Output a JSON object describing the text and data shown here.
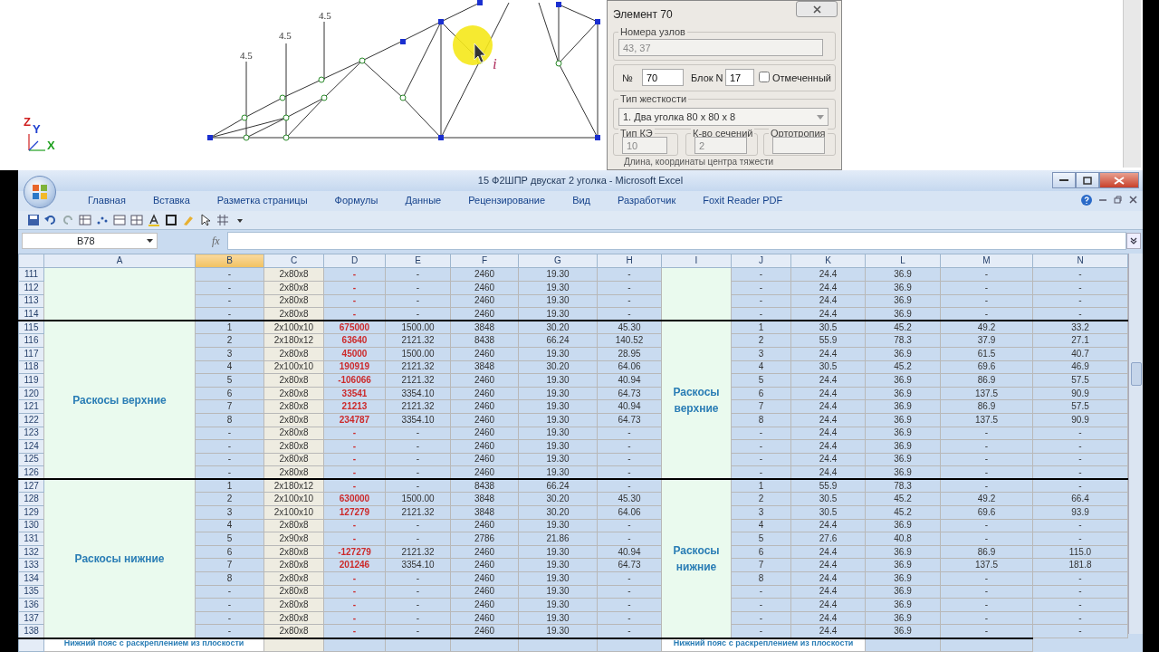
{
  "cad": {
    "load_labels": [
      "4.5",
      "4.5",
      "4.5"
    ],
    "cursor_label": "i",
    "axes": [
      "Z",
      "Y",
      "X"
    ]
  },
  "dialog": {
    "title": "Элемент 70",
    "nodes_group": "Номера узлов",
    "nodes_value": "43, 37",
    "number_label": "№",
    "number_value": "70",
    "block_label": "Блок N",
    "block_value": "17",
    "marked": {
      "label": "Отмеченный",
      "checked": false
    },
    "stiffness_group": "Тип жесткости",
    "stiffness_value": "1. Два уголка 80 x 80 x 8",
    "fields": [
      {
        "label": "Тип КЭ",
        "value": "10"
      },
      {
        "label": "К-во сечений",
        "value": "2"
      },
      {
        "label": "Ортотропия"
      }
    ],
    "cut_text": "Длина, координаты центра тяжести"
  },
  "excel": {
    "title": "15 Ф2ШПР двускат 2 уголка - Microsoft Excel",
    "ribbon_tabs": [
      "Главная",
      "Вставка",
      "Разметка страницы",
      "Формулы",
      "Данные",
      "Рецензирование",
      "Вид",
      "Разработчик",
      "Foxit Reader PDF"
    ],
    "name_box": "B78",
    "function_label": "fx",
    "columns": [
      {
        "label": "A",
        "selected": false
      },
      {
        "label": "B",
        "selected": true
      },
      {
        "label": "C",
        "selected": false
      },
      {
        "label": "D",
        "selected": false
      },
      {
        "label": "E",
        "selected": false
      },
      {
        "label": "F",
        "selected": false
      },
      {
        "label": "G",
        "selected": false
      },
      {
        "label": "H",
        "selected": false
      },
      {
        "label": "I",
        "selected": false
      },
      {
        "label": "J",
        "selected": false
      },
      {
        "label": "K",
        "selected": false
      },
      {
        "label": "L",
        "selected": false
      },
      {
        "label": "M",
        "selected": false
      },
      {
        "label": "N",
        "selected": false
      }
    ],
    "groups": [
      {
        "rows": [
          {
            "number": "111",
            "cells": [
              "-",
              "2x80x8",
              "-",
              "-",
              "2460",
              "19.30",
              "-",
              "-",
              "24.4",
              "36.9",
              "-",
              "-"
            ]
          },
          {
            "number": "112",
            "cells": [
              "-",
              "2x80x8",
              "-",
              "-",
              "2460",
              "19.30",
              "-",
              "-",
              "24.4",
              "36.9",
              "-",
              "-"
            ]
          },
          {
            "number": "113",
            "cells": [
              "-",
              "2x80x8",
              "-",
              "-",
              "2460",
              "19.30",
              "-",
              "-",
              "24.4",
              "36.9",
              "-",
              "-"
            ]
          },
          {
            "number": "114",
            "cells": [
              "-",
              "2x80x8",
              "-",
              "-",
              "2460",
              "19.30",
              "-",
              "-",
              "24.4",
              "36.9",
              "-",
              "-"
            ]
          }
        ]
      },
      {
        "label_left": "Раскосы верхние",
        "label_right": "Раскосы верхние",
        "rows": [
          {
            "number": "115",
            "cells": [
              "1",
              "2x100x10",
              "675000",
              "1500.00",
              "3848",
              "30.20",
              "45.30",
              "1",
              "30.5",
              "45.2",
              "49.2",
              "33.2"
            ]
          },
          {
            "number": "116",
            "cells": [
              "2",
              "2x180x12",
              "63640",
              "2121.32",
              "8438",
              "66.24",
              "140.52",
              "2",
              "55.9",
              "78.3",
              "37.9",
              "27.1"
            ]
          },
          {
            "number": "117",
            "cells": [
              "3",
              "2x80x8",
              "45000",
              "1500.00",
              "2460",
              "19.30",
              "28.95",
              "3",
              "24.4",
              "36.9",
              "61.5",
              "40.7"
            ]
          },
          {
            "number": "118",
            "cells": [
              "4",
              "2x100x10",
              "190919",
              "2121.32",
              "3848",
              "30.20",
              "64.06",
              "4",
              "30.5",
              "45.2",
              "69.6",
              "46.9"
            ]
          },
          {
            "number": "119",
            "cells": [
              "5",
              "2x80x8",
              "-106066",
              "2121.32",
              "2460",
              "19.30",
              "40.94",
              "5",
              "24.4",
              "36.9",
              "86.9",
              "57.5"
            ]
          },
          {
            "number": "120",
            "cells": [
              "6",
              "2x80x8",
              "33541",
              "3354.10",
              "2460",
              "19.30",
              "64.73",
              "6",
              "24.4",
              "36.9",
              "137.5",
              "90.9"
            ]
          },
          {
            "number": "121",
            "cells": [
              "7",
              "2x80x8",
              "21213",
              "2121.32",
              "2460",
              "19.30",
              "40.94",
              "7",
              "24.4",
              "36.9",
              "86.9",
              "57.5"
            ]
          },
          {
            "number": "122",
            "cells": [
              "8",
              "2x80x8",
              "234787",
              "3354.10",
              "2460",
              "19.30",
              "64.73",
              "8",
              "24.4",
              "36.9",
              "137.5",
              "90.9"
            ]
          },
          {
            "number": "123",
            "cells": [
              "-",
              "2x80x8",
              "-",
              "-",
              "2460",
              "19.30",
              "-",
              "-",
              "24.4",
              "36.9",
              "-",
              "-"
            ]
          },
          {
            "number": "124",
            "cells": [
              "-",
              "2x80x8",
              "-",
              "-",
              "2460",
              "19.30",
              "-",
              "-",
              "24.4",
              "36.9",
              "-",
              "-"
            ]
          },
          {
            "number": "125",
            "cells": [
              "-",
              "2x80x8",
              "-",
              "-",
              "2460",
              "19.30",
              "-",
              "-",
              "24.4",
              "36.9",
              "-",
              "-"
            ]
          },
          {
            "number": "126",
            "cells": [
              "-",
              "2x80x8",
              "-",
              "-",
              "2460",
              "19.30",
              "-",
              "-",
              "24.4",
              "36.9",
              "-",
              "-"
            ]
          }
        ]
      },
      {
        "label_left": "Раскосы нижние",
        "label_right": "Раскосы нижние",
        "rows": [
          {
            "number": "127",
            "cells": [
              "1",
              "2x180x12",
              "-",
              "-",
              "8438",
              "66.24",
              "-",
              "1",
              "55.9",
              "78.3",
              "-",
              "-"
            ]
          },
          {
            "number": "128",
            "cells": [
              "2",
              "2x100x10",
              "630000",
              "1500.00",
              "3848",
              "30.20",
              "45.30",
              "2",
              "30.5",
              "45.2",
              "49.2",
              "66.4"
            ]
          },
          {
            "number": "129",
            "cells": [
              "3",
              "2x100x10",
              "127279",
              "2121.32",
              "3848",
              "30.20",
              "64.06",
              "3",
              "30.5",
              "45.2",
              "69.6",
              "93.9"
            ]
          },
          {
            "number": "130",
            "cells": [
              "4",
              "2x80x8",
              "-",
              "-",
              "2460",
              "19.30",
              "-",
              "4",
              "24.4",
              "36.9",
              "-",
              "-"
            ]
          },
          {
            "number": "131",
            "cells": [
              "5",
              "2x90x8",
              "-",
              "-",
              "2786",
              "21.86",
              "-",
              "5",
              "27.6",
              "40.8",
              "-",
              "-"
            ]
          },
          {
            "number": "132",
            "cells": [
              "6",
              "2x80x8",
              "-127279",
              "2121.32",
              "2460",
              "19.30",
              "40.94",
              "6",
              "24.4",
              "36.9",
              "86.9",
              "115.0"
            ]
          },
          {
            "number": "133",
            "cells": [
              "7",
              "2x80x8",
              "201246",
              "3354.10",
              "2460",
              "19.30",
              "64.73",
              "7",
              "24.4",
              "36.9",
              "137.5",
              "181.8"
            ]
          },
          {
            "number": "134",
            "cells": [
              "8",
              "2x80x8",
              "-",
              "-",
              "2460",
              "19.30",
              "-",
              "8",
              "24.4",
              "36.9",
              "-",
              "-"
            ]
          },
          {
            "number": "135",
            "cells": [
              "-",
              "2x80x8",
              "-",
              "-",
              "2460",
              "19.30",
              "-",
              "-",
              "24.4",
              "36.9",
              "-",
              "-"
            ]
          },
          {
            "number": "136",
            "cells": [
              "-",
              "2x80x8",
              "-",
              "-",
              "2460",
              "19.30",
              "-",
              "-",
              "24.4",
              "36.9",
              "-",
              "-"
            ]
          },
          {
            "number": "137",
            "cells": [
              "-",
              "2x80x8",
              "-",
              "-",
              "2460",
              "19.30",
              "-",
              "-",
              "24.4",
              "36.9",
              "-",
              "-"
            ]
          },
          {
            "number": "138",
            "cells": [
              "-",
              "2x80x8",
              "-",
              "-",
              "2460",
              "19.30",
              "-",
              "-",
              "24.4",
              "36.9",
              "-",
              "-"
            ]
          }
        ]
      }
    ],
    "footer": {
      "left": "Нижний пояс с раскреплением из плоскости",
      "right": "Нижний пояс с раскреплением из плоскости"
    }
  }
}
